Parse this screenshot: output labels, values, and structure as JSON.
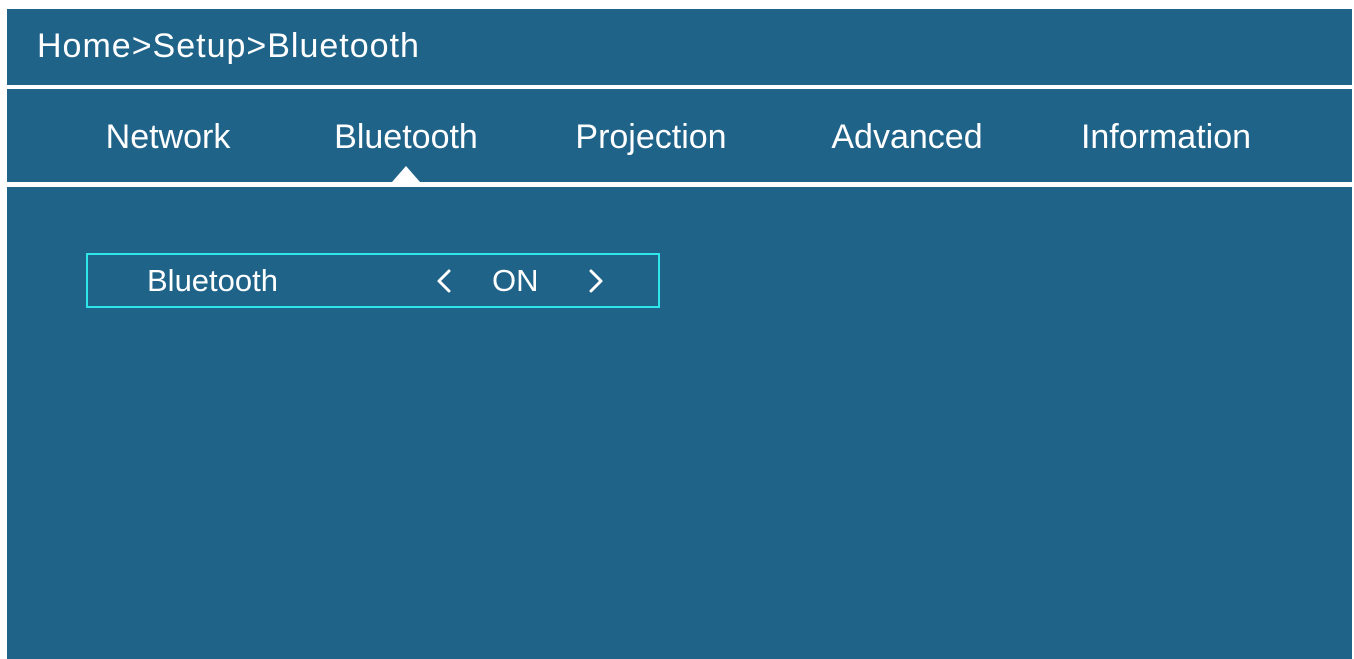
{
  "header": {
    "breadcrumb": "Home>Setup>Bluetooth"
  },
  "tabs": [
    {
      "label": "Network",
      "active": false
    },
    {
      "label": "Bluetooth",
      "active": true
    },
    {
      "label": "Projection",
      "active": false
    },
    {
      "label": "Advanced",
      "active": false
    },
    {
      "label": "Information",
      "active": false
    }
  ],
  "settings": [
    {
      "label": "Bluetooth",
      "value": "ON",
      "prev_icon": "chevron-left-icon",
      "next_icon": "chevron-right-icon",
      "focused": true
    }
  ],
  "colors": {
    "background": "#1f6389",
    "text": "#ffffff",
    "divider": "#ffffff",
    "focus_border": "#2ee6ea"
  }
}
